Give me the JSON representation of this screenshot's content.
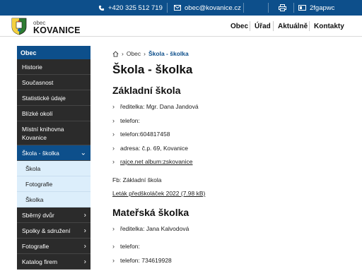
{
  "topbar": {
    "phone": "+420 325 512 719",
    "email": "obec@kovanice.cz",
    "print_icon": "printer-icon",
    "code": "2fgapwc"
  },
  "header": {
    "brand_small": "obec",
    "brand_big": "KOVANICE",
    "nav": [
      "Obec",
      "Úřad",
      "Aktuálně",
      "Kontakty"
    ]
  },
  "sidebar": {
    "head": "Obec",
    "items": [
      {
        "label": "Historie"
      },
      {
        "label": "Současnost"
      },
      {
        "label": "Statistické údaje"
      },
      {
        "label": "Blízké okolí"
      },
      {
        "label": "Místní knihovna Kovanice"
      },
      {
        "label": "Škola - školka"
      },
      {
        "label": "Škola"
      },
      {
        "label": "Fotografie"
      },
      {
        "label": "Školka"
      },
      {
        "label": "Sběrný dvůr"
      },
      {
        "label": "Spolky & sdružení"
      },
      {
        "label": "Fotografie"
      },
      {
        "label": "Katalog firem"
      }
    ]
  },
  "breadcrumb": {
    "home_icon": "home-icon",
    "parent": "Obec",
    "current": "Škola - školka"
  },
  "page": {
    "title": "Škola - školka",
    "school": {
      "heading": "Základní škola",
      "items": [
        "ředitelka: Mgr. Dana Jandová",
        "telefon:",
        "telefon:604817458",
        "adresa: č.p. 69, Kovanice",
        "rajce.net album:zskovanice"
      ],
      "fb": "Fb: Základní škola",
      "leaflet": "Leták předškoláček 2022 (7.98 kB)"
    },
    "kindergarten": {
      "heading": "Mateřská školka",
      "items": [
        "ředitelka: Jana Kalvodová",
        "telefon:",
        "telefon: 734619928"
      ]
    }
  },
  "colors": {
    "primary": "#0d4f8b",
    "sidebar_dark": "#2b2b2b",
    "sidebar_sub": "#dceefb"
  }
}
